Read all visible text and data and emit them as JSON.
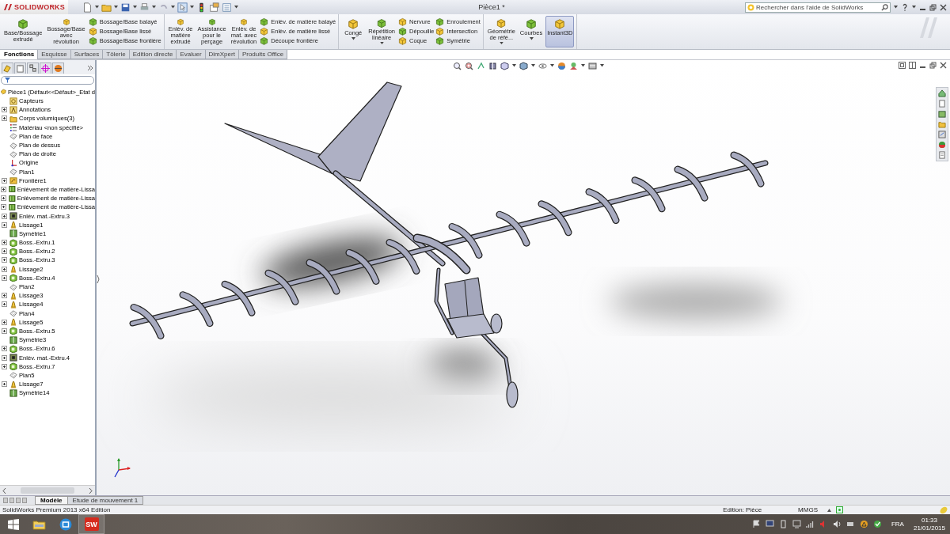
{
  "app": {
    "logo": "SOLIDWORKS",
    "title": "Pièce1 *"
  },
  "search": {
    "placeholder": "Rechercher dans l'aide de SolidWorks"
  },
  "ribbon": {
    "groups": [
      [
        {
          "kind": "large",
          "label": "Base/Bossage\nextrudé",
          "dropdown": false,
          "selected": false
        },
        {
          "kind": "large",
          "label": "Bossage/Base\navec\nrévolution",
          "dropdown": false,
          "selected": false
        },
        {
          "kind": "stack",
          "items": [
            "Bossage/Base balayé",
            "Bossage/Base lissé",
            "Bossage/Base frontière"
          ]
        }
      ],
      [
        {
          "kind": "large",
          "label": "Enlèv. de\nmatière\nextrudé",
          "dropdown": false,
          "selected": false
        },
        {
          "kind": "large",
          "label": "Assistance\npour le\nperçage",
          "dropdown": false,
          "selected": false
        },
        {
          "kind": "large",
          "label": "Enlèv. de\nmat. avec\nrévolution",
          "dropdown": false,
          "selected": false
        },
        {
          "kind": "stack",
          "items": [
            "Enlèv. de matière balayé",
            "Enlèv. de matière lissé",
            "Découpe frontière"
          ]
        }
      ],
      [
        {
          "kind": "large",
          "label": "Congé",
          "dropdown": true,
          "selected": false
        },
        {
          "kind": "large",
          "label": "Répétition\nlinéaire",
          "dropdown": true,
          "selected": false
        },
        {
          "kind": "stack",
          "items": [
            "Nervure",
            "Dépouille",
            "Coque"
          ]
        },
        {
          "kind": "stack",
          "items": [
            "Enroulement",
            "Intersection",
            "Symétrie"
          ]
        }
      ],
      [
        {
          "kind": "large",
          "label": "Géométrie\nde réfé...",
          "dropdown": true,
          "selected": false
        },
        {
          "kind": "large",
          "label": "Courbes",
          "dropdown": true,
          "selected": false
        },
        {
          "kind": "large",
          "label": "Instant3D",
          "dropdown": false,
          "selected": true
        }
      ]
    ]
  },
  "tabs": [
    {
      "label": "Fonctions",
      "selected": true
    },
    {
      "label": "Esquisse",
      "selected": false
    },
    {
      "label": "Surfaces",
      "selected": false
    },
    {
      "label": "Tôlerie",
      "selected": false
    },
    {
      "label": "Edition directe",
      "selected": false
    },
    {
      "label": "Evaluer",
      "selected": false
    },
    {
      "label": "DimXpert",
      "selected": false
    },
    {
      "label": "Produits Office",
      "selected": false
    }
  ],
  "tree": {
    "root": "Pièce1  (Défaut<<Défaut>_Etat d",
    "items": [
      {
        "label": "Capteurs",
        "kind": "sensor",
        "collapsed": false
      },
      {
        "label": "Annotations",
        "kind": "annotation",
        "collapsed": true
      },
      {
        "label": "Corps volumiques(3)",
        "kind": "folder",
        "collapsed": true
      },
      {
        "label": "Matériau <non spécifié>",
        "kind": "material",
        "collapsed": false
      },
      {
        "label": "Plan de face",
        "kind": "plane",
        "collapsed": false
      },
      {
        "label": "Plan de dessus",
        "kind": "plane",
        "collapsed": false
      },
      {
        "label": "Plan de droite",
        "kind": "plane",
        "collapsed": false
      },
      {
        "label": "Origine",
        "kind": "origin",
        "collapsed": false
      },
      {
        "label": "Plan1",
        "kind": "plane",
        "collapsed": false
      },
      {
        "label": "Frontière1",
        "kind": "boundary",
        "collapsed": true
      },
      {
        "label": "Enlèvement de matière-Lissa",
        "kind": "cut_loft",
        "collapsed": true
      },
      {
        "label": "Enlèvement de matière-Lissa",
        "kind": "cut_loft",
        "collapsed": true
      },
      {
        "label": "Enlèvement de matière-Lissa",
        "kind": "cut_loft",
        "collapsed": true
      },
      {
        "label": "Enlèv. mat.-Extru.3",
        "kind": "cut_extrude",
        "collapsed": true
      },
      {
        "label": "Lissage1",
        "kind": "loft",
        "collapsed": true
      },
      {
        "label": "Symétrie1",
        "kind": "mirror",
        "collapsed": false
      },
      {
        "label": "Boss.-Extru.1",
        "kind": "boss_extrude",
        "collapsed": true
      },
      {
        "label": "Boss.-Extru.2",
        "kind": "boss_extrude",
        "collapsed": true
      },
      {
        "label": "Boss.-Extru.3",
        "kind": "boss_extrude",
        "collapsed": true
      },
      {
        "label": "Lissage2",
        "kind": "loft",
        "collapsed": true
      },
      {
        "label": "Boss.-Extru.4",
        "kind": "boss_extrude",
        "collapsed": true
      },
      {
        "label": "Plan2",
        "kind": "plane",
        "collapsed": false
      },
      {
        "label": "Lissage3",
        "kind": "loft",
        "collapsed": true
      },
      {
        "label": "Lissage4",
        "kind": "loft",
        "collapsed": true
      },
      {
        "label": "Plan4",
        "kind": "plane",
        "collapsed": false
      },
      {
        "label": "Lissage5",
        "kind": "loft",
        "collapsed": true
      },
      {
        "label": "Boss.-Extru.5",
        "kind": "boss_extrude",
        "collapsed": true
      },
      {
        "label": "Symétrie3",
        "kind": "mirror",
        "collapsed": false
      },
      {
        "label": "Boss.-Extru.6",
        "kind": "boss_extrude",
        "collapsed": true
      },
      {
        "label": "Enlèv. mat.-Extru.4",
        "kind": "cut_extrude",
        "collapsed": true
      },
      {
        "label": "Boss.-Extru.7",
        "kind": "boss_extrude",
        "collapsed": true
      },
      {
        "label": "Plan5",
        "kind": "plane",
        "collapsed": false
      },
      {
        "label": "Lissage7",
        "kind": "loft",
        "collapsed": true
      },
      {
        "label": "Symétrie14",
        "kind": "mirror",
        "collapsed": false
      }
    ]
  },
  "bottom_tabs": [
    {
      "label": "Modèle",
      "selected": true
    },
    {
      "label": "Etude de mouvement 1",
      "selected": false
    }
  ],
  "status_bar": {
    "product": "SolidWorks Premium 2013 x64 Edition",
    "mode": "Edition: Pièce",
    "units": "MMGS"
  },
  "taskbar": {
    "app_badge": "SW",
    "language": "FRA",
    "time": "01:33",
    "date": "21/01/2015"
  }
}
